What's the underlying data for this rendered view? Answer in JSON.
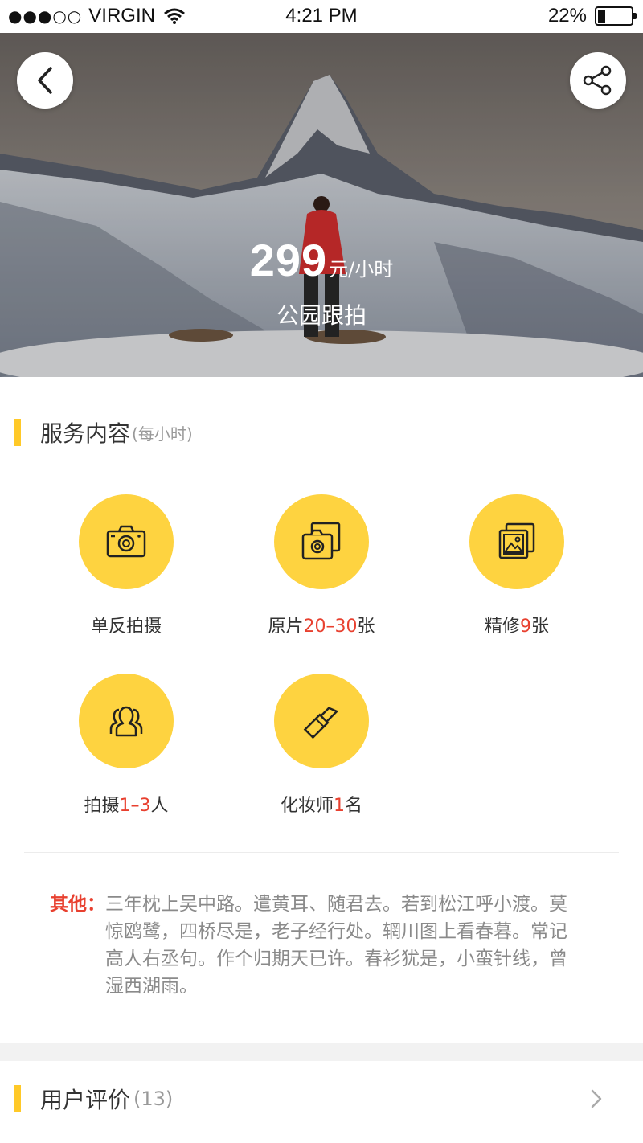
{
  "status_bar": {
    "signal": "●●●○○",
    "carrier": "VIRGIN",
    "time": "4:21 PM",
    "battery": "22%",
    "battery_level": 0.22
  },
  "hero": {
    "price": "299",
    "price_unit": "元/小时",
    "title": "公园跟拍",
    "back_icon": "chevron-left-icon",
    "share_icon": "share-icon"
  },
  "service": {
    "title": "服务内容",
    "subtitle": "(每小时)",
    "items": [
      {
        "icon": "camera-icon",
        "prefix": "单反拍摄",
        "highlight": "",
        "suffix": ""
      },
      {
        "icon": "photos-camera-icon",
        "prefix": "原片",
        "highlight": "20–30",
        "suffix": "张"
      },
      {
        "icon": "gallery-icon",
        "prefix": "精修",
        "highlight": "9",
        "suffix": "张"
      },
      {
        "icon": "people-icon",
        "prefix": "拍摄",
        "highlight": "1–3",
        "suffix": "人"
      },
      {
        "icon": "lipstick-icon",
        "prefix": "化妆师",
        "highlight": "1",
        "suffix": "名"
      }
    ],
    "accent_color": "#fed340",
    "highlight_color": "#e8402f"
  },
  "other": {
    "label": "其他：",
    "text": "三年枕上吴中路。遣黄耳、随君去。若到松江呼小渡。莫惊鸥鹭，四桥尽是，老子经行处。辋川图上看春暮。常记高人右丞句。作个归期天已许。春衫犹是，小蛮针线，曾湿西湖雨。"
  },
  "reviews": {
    "title": "用户评价",
    "count": "(13)",
    "chevron_icon": "chevron-right-icon"
  }
}
